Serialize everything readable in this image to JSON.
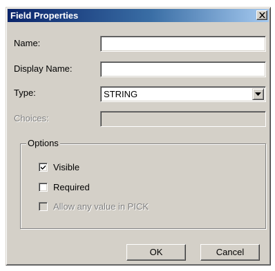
{
  "window": {
    "title": "Field Properties",
    "close_glyph": "✕"
  },
  "form": {
    "name": {
      "label": "Name:",
      "value": ""
    },
    "display_name": {
      "label": "Display Name:",
      "value": ""
    },
    "type": {
      "label": "Type:",
      "selected": "STRING"
    },
    "choices": {
      "label": "Choices:",
      "value": "",
      "enabled": false
    }
  },
  "options": {
    "legend": "Options",
    "items": [
      {
        "label": "Visible",
        "checked": true,
        "enabled": true
      },
      {
        "label": "Required",
        "checked": false,
        "enabled": true
      },
      {
        "label": "Allow any value in PICK",
        "checked": false,
        "enabled": false
      }
    ]
  },
  "buttons": {
    "ok": "OK",
    "cancel": "Cancel"
  },
  "colors": {
    "titlebar_start": "#0a246a",
    "titlebar_end": "#a6caf0",
    "face": "#d4d0c8",
    "disabled_text": "#808080"
  }
}
